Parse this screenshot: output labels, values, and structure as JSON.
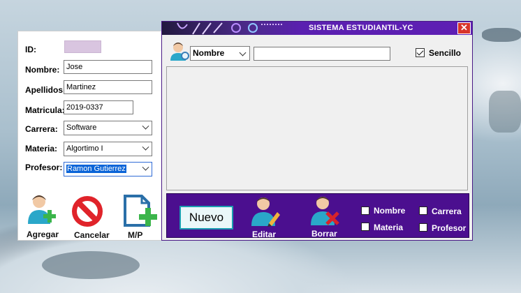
{
  "left_form": {
    "labels": {
      "id": "ID:",
      "nombre": "Nombre:",
      "apellidos": "Apellidos:",
      "matricula": "Matricula:",
      "carrera": "Carrera:",
      "materia": "Materia:",
      "profesor": "Profesor:"
    },
    "values": {
      "id": "",
      "nombre": "Jose",
      "apellidos": "Martinez",
      "matricula": "2019-0337",
      "carrera": "Software",
      "materia": "Algortimo I",
      "profesor": "Ramon Gutierrez"
    },
    "actions": {
      "agregar": "Agregar",
      "cancelar": "Cancelar",
      "mp": "M/P"
    }
  },
  "main_window": {
    "title": "SISTEMA ESTUDIANTIL-YC",
    "close_glyph": "✕",
    "search": {
      "combo_value": "Nombre",
      "input_value": "",
      "sencillo_label": "Sencillo",
      "sencillo_checked": true
    },
    "bottom_panel": {
      "nuevo_label": "Nuevo",
      "editar_label": "Editar",
      "borrar_label": "Borrar",
      "filters": [
        {
          "label": "Nombre",
          "checked": false
        },
        {
          "label": "Carrera",
          "checked": false
        },
        {
          "label": "Materia",
          "checked": false
        },
        {
          "label": "Profesor",
          "checked": false
        }
      ]
    }
  },
  "colors": {
    "titlebar": "#5a1fb0",
    "panel": "#4b0f8f",
    "close": "#d8342a",
    "id_field": "#d9c5e0",
    "selection": "#0a64d8",
    "nuevo_border": "#1b9db1"
  },
  "icons": {
    "user_add": "user-add-icon",
    "cancel": "cancel-icon",
    "document_add": "document-add-icon",
    "user_edit": "user-edit-icon",
    "user_delete": "user-delete-icon",
    "user_search": "user-search-icon"
  }
}
